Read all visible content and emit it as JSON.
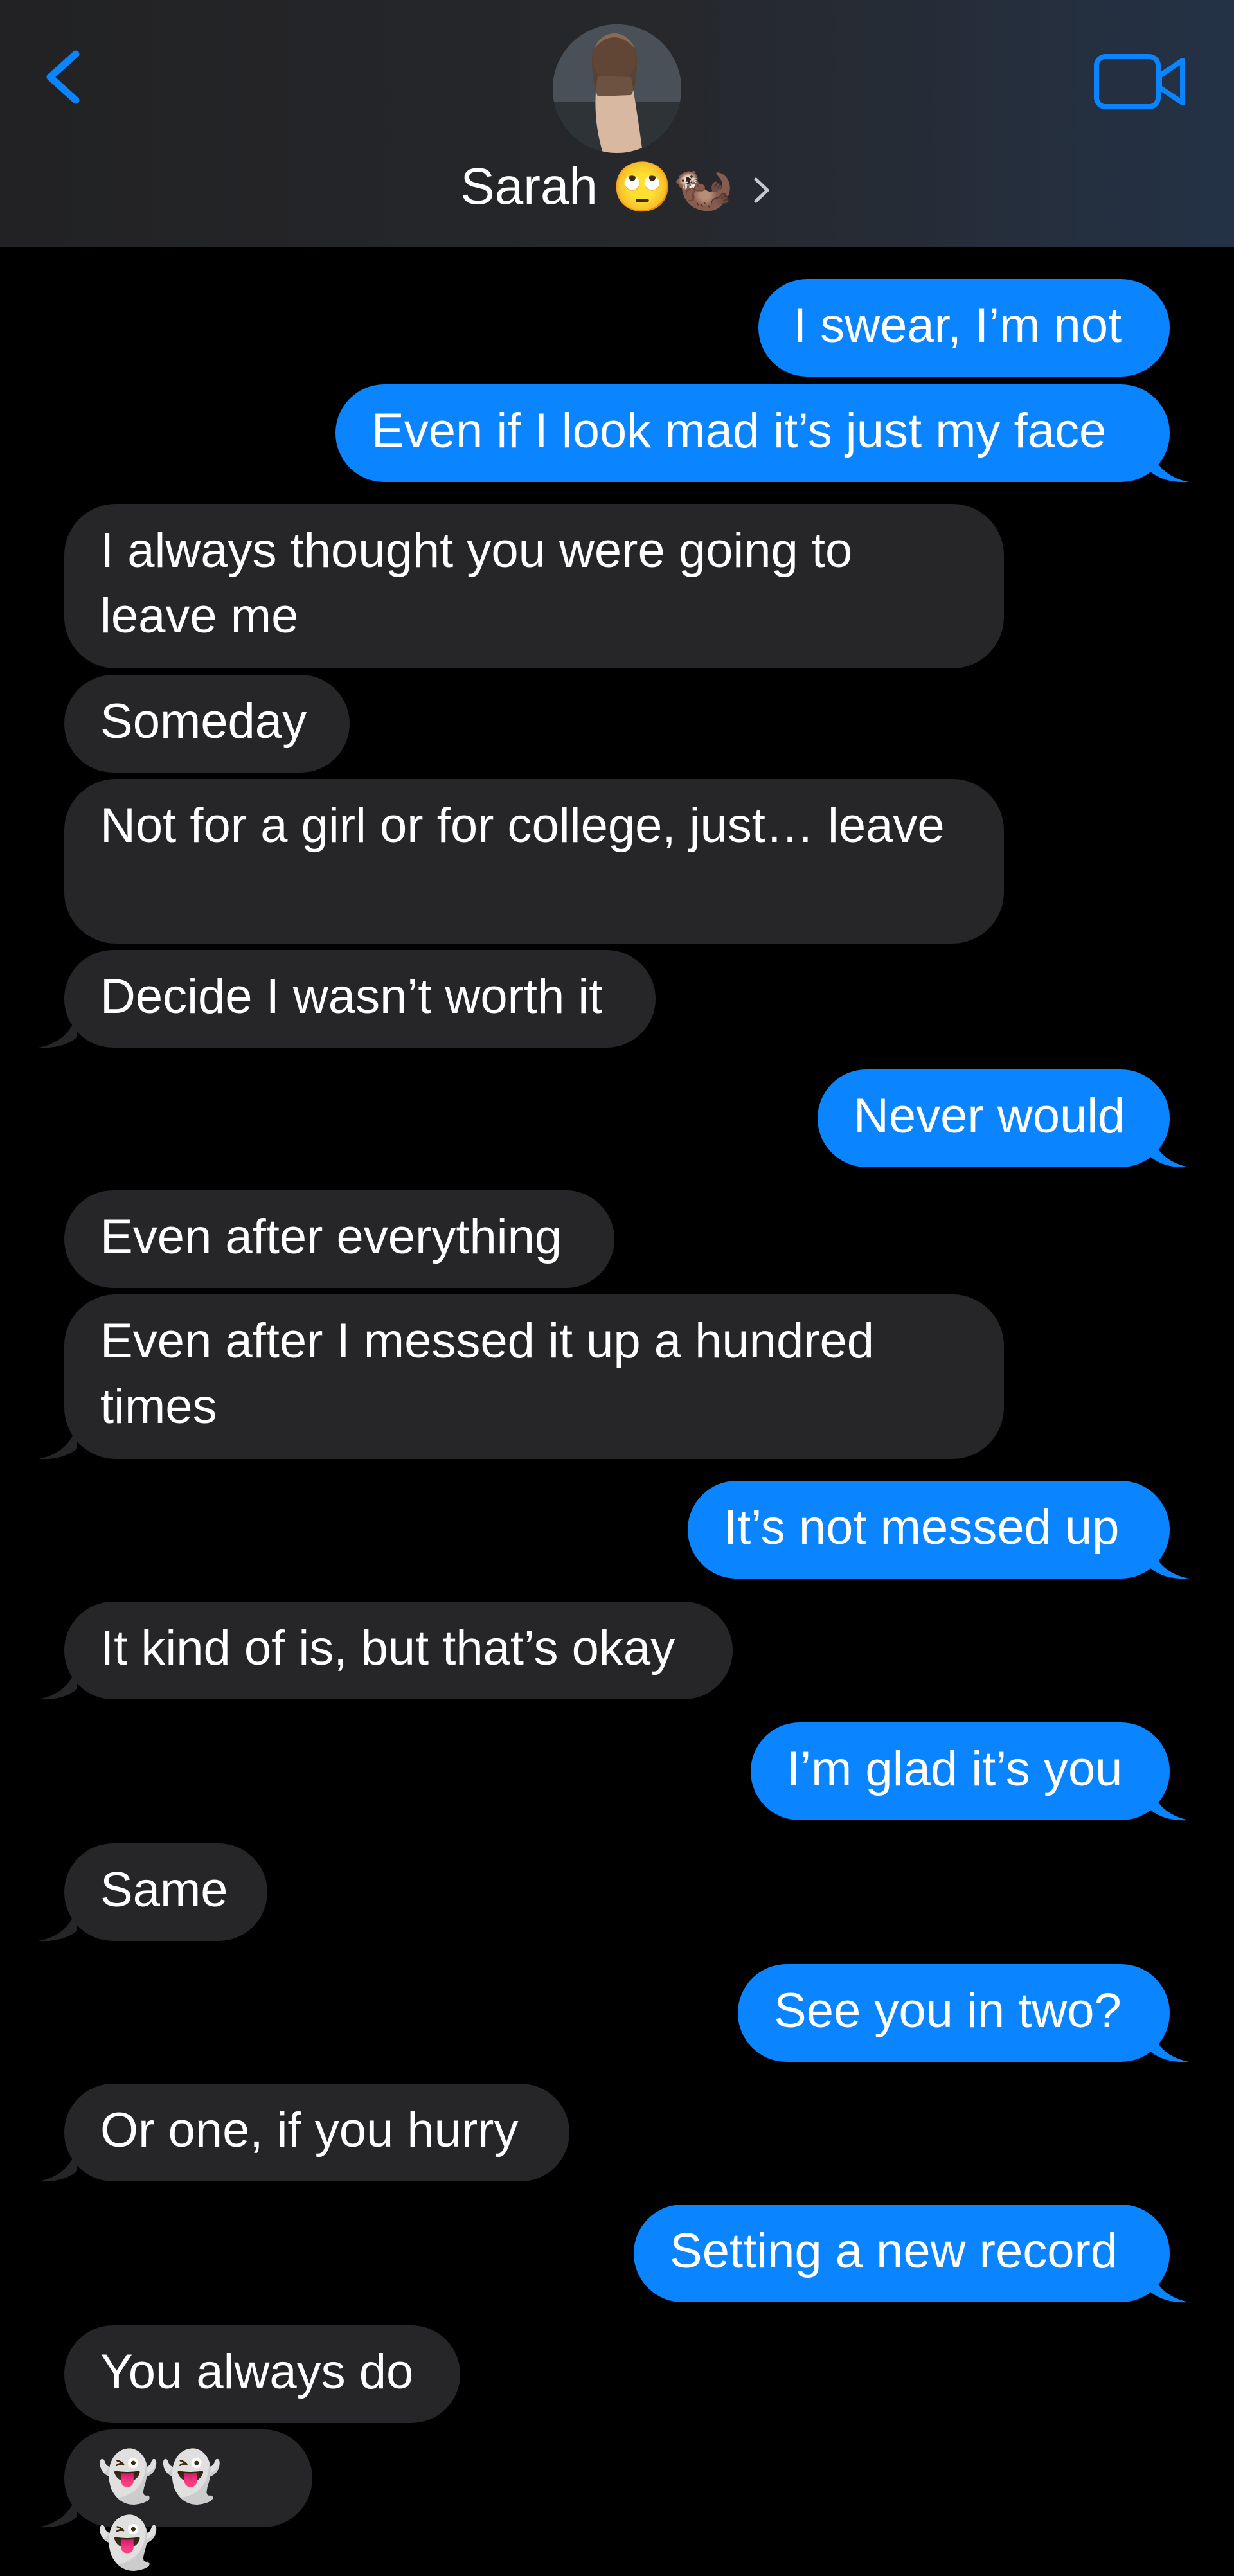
{
  "header": {
    "contact_name": "Sarah",
    "name_emojis": "🙄🦦",
    "icons": {
      "back": "chevron-left-icon",
      "video": "video-camera-icon",
      "details": "chevron-right-icon"
    },
    "colors": {
      "accent": "#0a84ff",
      "header_bg": "#232427",
      "received_bubble": "#262628",
      "sent_bubble": "#0a84ff",
      "background": "#000000"
    }
  },
  "messages": [
    {
      "from": "me",
      "text": "I swear, I’m not"
    },
    {
      "from": "me",
      "text": "Even if I look mad it’s just my face"
    },
    {
      "from": "them",
      "text": "I always thought you were going to leave me"
    },
    {
      "from": "them",
      "text": "Someday"
    },
    {
      "from": "them",
      "text": "Not for a girl or for college, just… leave"
    },
    {
      "from": "them",
      "text": "Decide I wasn’t worth it"
    },
    {
      "from": "me",
      "text": "Never would"
    },
    {
      "from": "them",
      "text": "Even after everything"
    },
    {
      "from": "them",
      "text": "Even after I messed it up a hundred times"
    },
    {
      "from": "me",
      "text": "It’s not messed up"
    },
    {
      "from": "them",
      "text": "It kind of is, but that’s okay"
    },
    {
      "from": "me",
      "text": "I’m glad it’s you"
    },
    {
      "from": "them",
      "text": "Same"
    },
    {
      "from": "me",
      "text": "See you in two?"
    },
    {
      "from": "them",
      "text": "Or one, if you hurry"
    },
    {
      "from": "me",
      "text": "Setting a new record"
    },
    {
      "from": "them",
      "text": "You always do"
    },
    {
      "from": "them",
      "text": "👻👻👻"
    }
  ]
}
